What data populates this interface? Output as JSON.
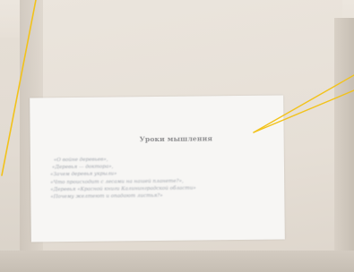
{
  "paper": {
    "title": "Уроки мышления",
    "lines": [
      "«О войне деревьев»,",
      "«Деревья — доктора»,",
      "«Зачем деревья укрыли»",
      "«Что происходит с лесами на нашей планете?»,",
      "«Деревья «Красной книги Калининградской области»",
      "«Почему желтеют и опадают листья?»"
    ]
  },
  "colors": {
    "leader_line": "#f2c21a",
    "paper": "#f7f6f4",
    "board": "#e6dfd6"
  }
}
